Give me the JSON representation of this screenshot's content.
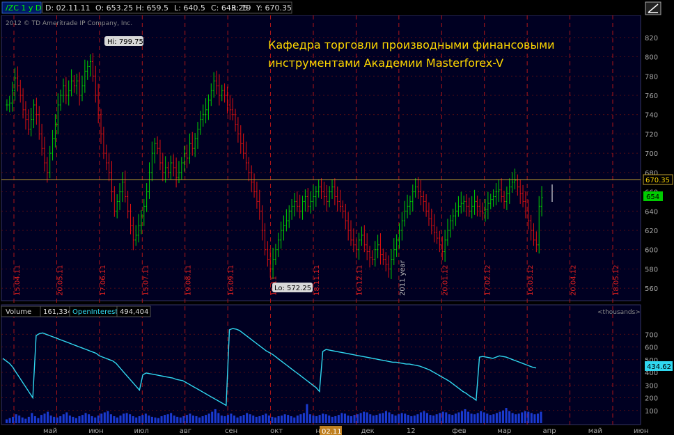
{
  "colors": {
    "background": "#000000",
    "panel": "#0a0a3a",
    "grid": "#6a1010",
    "up": "#00d000",
    "down": "#e01010",
    "oi_line": "#30d8f0",
    "volume": "#1a3ad0",
    "title": "#ffd800",
    "accent_green": "#00cc00"
  },
  "header": {
    "symbol": "/ZC 1 y D",
    "date": "D: 02.11.11",
    "open": "O: 653.25",
    "high": "H: 659.5",
    "low": "L: 640.5",
    "close": "C: 643.25",
    "range": "R: 19",
    "y": "Y: 670.35",
    "copyright": "2012 © TD Ameritrade IP Company, Inc.",
    "drawing_tool_icon": "line-tool-icon"
  },
  "title": {
    "line1": "Кафедра торговли производными финансовыми",
    "line2": "инструментами Академии Masterforex-V"
  },
  "markers": {
    "hi": "Hi: 799.75",
    "lo": "Lo: 572.25",
    "cursor_price": "670.35",
    "last_price": "654",
    "oi_value": "434.62",
    "x_cursor_label": "02.11"
  },
  "lower_header": {
    "volume_label": "Volume",
    "volume_value": "161,334",
    "oi_label": "OpenInterest",
    "oi_value": "494,404",
    "units": "<thousands>"
  },
  "chart_data": [
    {
      "type": "candlestick",
      "ylim": [
        550,
        830
      ],
      "yticks": [
        560,
        580,
        600,
        620,
        640,
        660,
        680,
        700,
        720,
        740,
        760,
        780,
        800,
        820
      ],
      "date_labels": [
        "15.04.11",
        "20.05.11",
        "17.06.11",
        "15.07.11",
        "19.08.11",
        "16.09.11",
        "10.11",
        "18.11.11",
        "16.12.11",
        "2011 year",
        "20.01.12",
        "17.02.12",
        "16.03.12",
        "20.04.12",
        "18.05.12"
      ],
      "hi": 799.75,
      "lo": 572.25,
      "cursor_price": 670.35,
      "last": 654,
      "closes": [
        750,
        752,
        765,
        778,
        770,
        760,
        745,
        735,
        725,
        735,
        750,
        740,
        720,
        705,
        690,
        680,
        700,
        715,
        730,
        750,
        760,
        770,
        760,
        765,
        775,
        770,
        775,
        760,
        770,
        785,
        790,
        795,
        780,
        760,
        740,
        720,
        700,
        690,
        680,
        660,
        640,
        650,
        660,
        670,
        655,
        640,
        625,
        610,
        615,
        625,
        635,
        645,
        660,
        680,
        700,
        710,
        705,
        690,
        680,
        685,
        680,
        690,
        685,
        675,
        680,
        690,
        700,
        695,
        710,
        705,
        715,
        725,
        735,
        740,
        745,
        755,
        765,
        775,
        770,
        760,
        765,
        760,
        750,
        745,
        740,
        730,
        720,
        710,
        700,
        690,
        680,
        670,
        660,
        650,
        640,
        620,
        600,
        590,
        580,
        590,
        600,
        610,
        620,
        625,
        630,
        640,
        645,
        650,
        645,
        640,
        650,
        655,
        645,
        650,
        655,
        660,
        665,
        660,
        655,
        650,
        660,
        665,
        655,
        650,
        645,
        640,
        630,
        620,
        610,
        605,
        600,
        610,
        615,
        605,
        598,
        592,
        590,
        600,
        605,
        595,
        590,
        585,
        580,
        590,
        600,
        610,
        620,
        630,
        640,
        645,
        650,
        660,
        665,
        660,
        655,
        650,
        640,
        632,
        625,
        618,
        612,
        605,
        598,
        610,
        620,
        630,
        635,
        640,
        645,
        648,
        650,
        645,
        640,
        645,
        650,
        645,
        640,
        638,
        642,
        648,
        652,
        655,
        660,
        662,
        655,
        650,
        658,
        665,
        670,
        672,
        665,
        658,
        650,
        640,
        630,
        620,
        610,
        605,
        645,
        654
      ]
    },
    {
      "type": "area-line",
      "series": [
        {
          "name": "Volume",
          "kind": "bars"
        },
        {
          "name": "OpenInterest",
          "kind": "line"
        }
      ],
      "ylim": [
        0,
        800
      ],
      "yticks": [
        100,
        200,
        300,
        400,
        500,
        600,
        700
      ],
      "x_labels": [
        "май",
        "июн",
        "июл",
        "авг",
        "сен",
        "окт",
        "н",
        "дек",
        "12",
        "фев",
        "мар",
        "апр",
        "май",
        "июн"
      ],
      "oi": [
        510,
        490,
        470,
        440,
        400,
        360,
        320,
        280,
        240,
        200,
        690,
        705,
        710,
        700,
        690,
        680,
        670,
        660,
        650,
        640,
        630,
        620,
        610,
        600,
        590,
        580,
        570,
        560,
        550,
        530,
        520,
        510,
        500,
        490,
        470,
        440,
        410,
        380,
        350,
        320,
        290,
        260,
        380,
        395,
        390,
        385,
        380,
        375,
        370,
        365,
        360,
        355,
        345,
        340,
        335,
        320,
        305,
        290,
        275,
        260,
        245,
        230,
        215,
        200,
        185,
        170,
        155,
        140,
        735,
        745,
        740,
        730,
        710,
        690,
        670,
        650,
        630,
        610,
        590,
        570,
        555,
        540,
        520,
        500,
        480,
        460,
        440,
        420,
        400,
        380,
        360,
        340,
        320,
        300,
        280,
        250,
        565,
        580,
        575,
        570,
        565,
        560,
        555,
        550,
        545,
        540,
        535,
        530,
        525,
        520,
        515,
        510,
        505,
        500,
        495,
        490,
        485,
        480,
        480,
        475,
        470,
        465,
        465,
        460,
        455,
        450,
        440,
        430,
        420,
        405,
        390,
        375,
        360,
        345,
        330,
        310,
        290,
        270,
        250,
        235,
        215,
        200,
        180,
        520,
        525,
        520,
        515,
        510,
        520,
        530,
        525,
        520,
        510,
        500,
        490,
        480,
        470,
        460,
        450,
        440,
        434.62
      ],
      "volume": [
        30,
        40,
        50,
        70,
        60,
        45,
        35,
        50,
        80,
        55,
        40,
        65,
        75,
        90,
        60,
        50,
        45,
        55,
        70,
        85,
        60,
        50,
        40,
        55,
        65,
        80,
        70,
        55,
        45,
        60,
        75,
        85,
        95,
        70,
        55,
        45,
        60,
        75,
        80,
        70,
        55,
        45,
        55,
        65,
        75,
        60,
        50,
        45,
        40,
        55,
        65,
        70,
        80,
        60,
        50,
        45,
        55,
        65,
        75,
        60,
        55,
        45,
        55,
        65,
        75,
        90,
        110,
        80,
        60,
        55,
        65,
        75,
        60,
        45,
        55,
        65,
        80,
        70,
        60,
        50,
        55,
        65,
        75,
        60,
        50,
        45,
        55,
        60,
        70,
        65,
        55,
        45,
        60,
        70,
        80,
        150,
        70,
        60,
        55,
        65,
        75,
        70,
        60,
        50,
        55,
        65,
        80,
        75,
        60,
        55,
        65,
        70,
        80,
        90,
        85,
        70,
        60,
        65,
        75,
        80,
        95,
        85,
        70,
        60,
        70,
        80,
        75,
        65,
        55,
        60,
        70,
        85,
        95,
        80,
        65,
        60,
        70,
        80,
        90,
        85,
        70,
        65,
        75,
        85,
        95,
        110,
        90,
        75,
        70,
        80,
        95,
        85,
        75,
        65,
        70,
        80,
        90,
        100,
        120,
        95,
        80,
        70,
        75,
        85,
        95,
        90,
        80,
        70,
        75,
        90
      ]
    }
  ]
}
